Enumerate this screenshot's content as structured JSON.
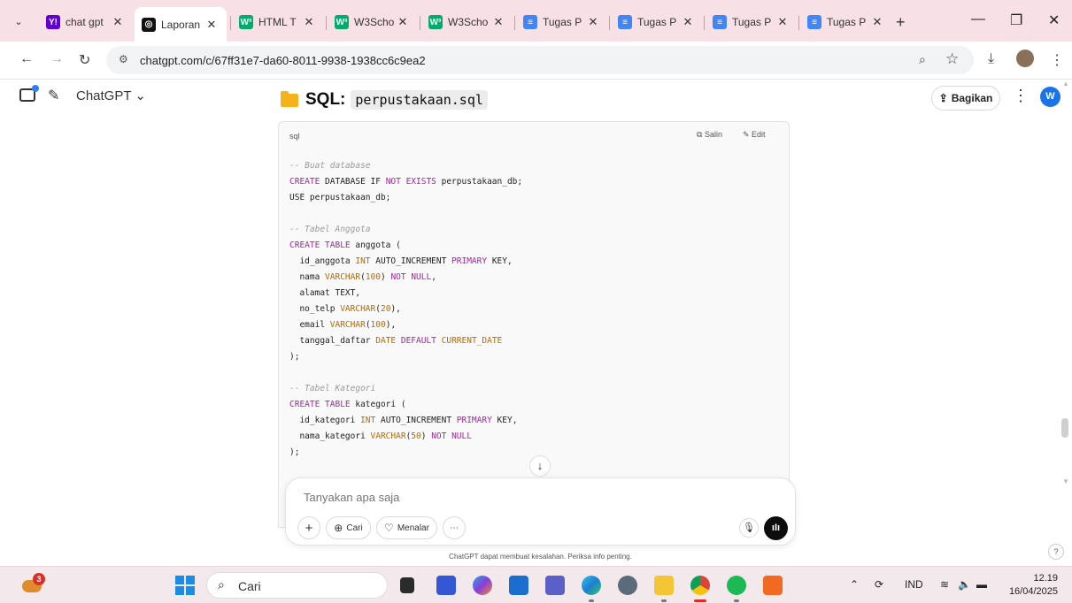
{
  "browser": {
    "tabs": [
      {
        "label": "chat gpt",
        "favicon": "Y!",
        "color": "#6001d2",
        "active": false
      },
      {
        "label": "Laporan",
        "favicon": "◎",
        "color": "#111111",
        "active": true
      },
      {
        "label": "HTML T",
        "favicon": "W³",
        "color": "#04aa6d",
        "active": false
      },
      {
        "label": "W3Scho",
        "favicon": "W³",
        "color": "#04aa6d",
        "active": false
      },
      {
        "label": "W3Scho",
        "favicon": "W³",
        "color": "#04aa6d",
        "active": false
      },
      {
        "label": "Tugas P",
        "favicon": "≡",
        "color": "#4285f4",
        "active": false
      },
      {
        "label": "Tugas P",
        "favicon": "≡",
        "color": "#4285f4",
        "active": false
      },
      {
        "label": "Tugas P",
        "favicon": "≡",
        "color": "#4285f4",
        "active": false
      },
      {
        "label": "Tugas P",
        "favicon": "≡",
        "color": "#4285f4",
        "active": false
      }
    ],
    "url": "chatgpt.com/c/67ff31e7-da60-8011-9938-1938cc6c9ea2"
  },
  "app": {
    "model_name": "ChatGPT ⌄",
    "share_label": "Bagikan",
    "avatar_initial": "W"
  },
  "message": {
    "heading_label": "SQL:",
    "heading_code": "perpustakaan.sql",
    "code_block": {
      "language": "sql",
      "copy_label": "Salin",
      "edit_label": "Edit",
      "lines": [
        [
          [
            "cmt",
            "-- Buat database"
          ]
        ],
        [
          [
            "kw",
            "CREATE"
          ],
          [
            "tx",
            " DATABASE IF "
          ],
          [
            "kw",
            "NOT EXISTS"
          ],
          [
            "tx",
            " perpustakaan_db;"
          ]
        ],
        [
          [
            "tx",
            "USE perpustakaan_db;"
          ]
        ],
        [],
        [
          [
            "cmt",
            "-- Tabel Anggota"
          ]
        ],
        [
          [
            "kw",
            "CREATE TABLE"
          ],
          [
            "tx",
            " anggota ("
          ]
        ],
        [
          [
            "tx",
            "  id_anggota "
          ],
          [
            "ty",
            "INT"
          ],
          [
            "tx",
            " AUTO_INCREMENT "
          ],
          [
            "kw",
            "PRIMARY"
          ],
          [
            "tx",
            " KEY,"
          ]
        ],
        [
          [
            "tx",
            "  nama "
          ],
          [
            "ty",
            "VARCHAR"
          ],
          [
            "tx",
            "("
          ],
          [
            "ty",
            "100"
          ],
          [
            "tx",
            ") "
          ],
          [
            "kw",
            "NOT NULL"
          ],
          [
            "tx",
            ","
          ]
        ],
        [
          [
            "tx",
            "  alamat TEXT,"
          ]
        ],
        [
          [
            "tx",
            "  no_telp "
          ],
          [
            "ty",
            "VARCHAR"
          ],
          [
            "tx",
            "("
          ],
          [
            "ty",
            "20"
          ],
          [
            "tx",
            "),"
          ]
        ],
        [
          [
            "tx",
            "  email "
          ],
          [
            "ty",
            "VARCHAR"
          ],
          [
            "tx",
            "("
          ],
          [
            "ty",
            "100"
          ],
          [
            "tx",
            "),"
          ]
        ],
        [
          [
            "tx",
            "  tanggal_daftar "
          ],
          [
            "ty",
            "DATE"
          ],
          [
            "tx",
            " "
          ],
          [
            "kw",
            "DEFAULT"
          ],
          [
            "tx",
            " "
          ],
          [
            "ty",
            "CURRENT_DATE"
          ]
        ],
        [
          [
            "tx",
            ");"
          ]
        ],
        [],
        [
          [
            "cmt",
            "-- Tabel Kategori"
          ]
        ],
        [
          [
            "kw",
            "CREATE TABLE"
          ],
          [
            "tx",
            " kategori ("
          ]
        ],
        [
          [
            "tx",
            "  id_kategori "
          ],
          [
            "ty",
            "INT"
          ],
          [
            "tx",
            " AUTO_INCREMENT "
          ],
          [
            "kw",
            "PRIMARY"
          ],
          [
            "tx",
            " KEY,"
          ]
        ],
        [
          [
            "tx",
            "  nama_kategori "
          ],
          [
            "ty",
            "VARCHAR"
          ],
          [
            "tx",
            "("
          ],
          [
            "ty",
            "50"
          ],
          [
            "tx",
            ") "
          ],
          [
            "kw",
            "NOT NULL"
          ]
        ],
        [
          [
            "tx",
            ");"
          ]
        ]
      ]
    }
  },
  "composer": {
    "placeholder": "Tanyakan apa saja",
    "search_label": "Cari",
    "reason_label": "Menalar",
    "disclaimer": "ChatGPT dapat membuat kesalahan. Periksa info penting."
  },
  "taskbar": {
    "weather_badge": "3",
    "search_label": "Cari",
    "language": "IND",
    "time": "12.19",
    "date": "16/04/2025"
  }
}
